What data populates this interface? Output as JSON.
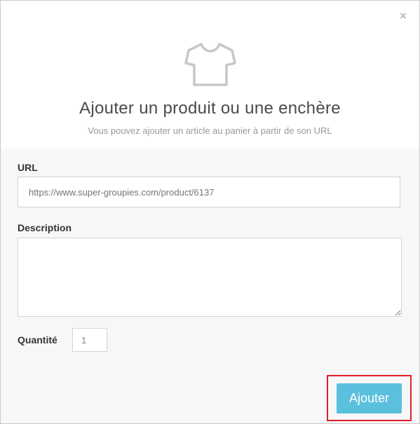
{
  "modal": {
    "close_glyph": "×",
    "title": "Ajouter un produit ou une enchère",
    "subtitle": "Vous pouvez ajouter un article au panier à partir de son URL"
  },
  "form": {
    "url_label": "URL",
    "url_placeholder": "https://www.super-groupies.com/product/6137",
    "description_label": "Description",
    "description_value": "",
    "quantity_label": "Quantité",
    "quantity_value": "1",
    "submit_label": "Ajouter"
  },
  "icons": {
    "header_icon": "tshirt-icon",
    "close_icon": "close-icon"
  },
  "colors": {
    "submit_button": "#5bc0de",
    "highlight_border": "#e0202a",
    "body_background": "#f7f7f7"
  }
}
